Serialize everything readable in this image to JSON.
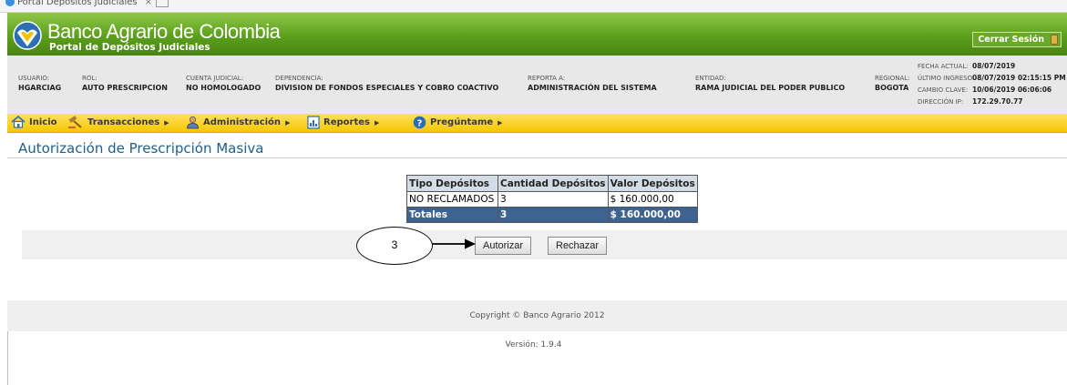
{
  "browser": {
    "tab_title": "Portal Depósitos Judiciales",
    "close_glyph": "×"
  },
  "header": {
    "bank_name": "Banco Agrario de Colombia",
    "portal_name": "Portal de Depósitos Judiciales",
    "logout_label": "Cerrar Sesión",
    "brand_color": "#5c9f1c"
  },
  "user_info": {
    "usuario": {
      "label": "USUARIO:",
      "value": "HGARCIAG"
    },
    "rol": {
      "label": "ROL:",
      "value": "AUTO PRESCRIPCION"
    },
    "cuenta": {
      "label": "CUENTA JUDICIAL:",
      "value": "NO HOMOLOGADO"
    },
    "dependencia": {
      "label": "DEPENDENCIA:",
      "value": "DIVISION DE FONDOS ESPECIALES Y COBRO COACTIVO"
    },
    "reporta": {
      "label": "REPORTA A:",
      "value": "ADMINISTRACIÓN DEL SISTEMA"
    },
    "entidad": {
      "label": "ENTIDAD:",
      "value": "RAMA JUDICIAL DEL PODER PUBLICO"
    },
    "regional": {
      "label": "REGIONAL:",
      "value": "BOGOTA"
    },
    "fecha_actual": {
      "label": "FECHA ACTUAL:",
      "value": "08/07/2019"
    },
    "ultimo_ingreso": {
      "label": "ÚLTIMO INGRESO:",
      "value": "08/07/2019 02:15:15 PM"
    },
    "cambio_clave": {
      "label": "CAMBIO CLAVE:",
      "value": "10/06/2019 06:06:06"
    },
    "direccion_ip": {
      "label": "DIRECCIÓN IP:",
      "value": "172.29.70.77"
    }
  },
  "menu": {
    "items": [
      {
        "label": "Inicio",
        "icon": "home-icon",
        "has_submenu": false
      },
      {
        "label": "Transacciones",
        "icon": "gavel-icon",
        "has_submenu": true
      },
      {
        "label": "Administración",
        "icon": "user-admin-icon",
        "has_submenu": true
      },
      {
        "label": "Reportes",
        "icon": "report-icon",
        "has_submenu": true
      },
      {
        "label": "Pregúntame",
        "icon": "help-icon",
        "has_submenu": true
      }
    ],
    "submenu_arrow": "▶"
  },
  "page": {
    "title": "Autorización de Prescripción Masiva"
  },
  "summary": {
    "headers": [
      "Tipo Depósitos",
      "Cantidad Depósitos",
      "Valor Depósitos"
    ],
    "rows": [
      [
        "NO RECLAMADOS",
        "3",
        "$ 160.000,00"
      ]
    ],
    "totals": [
      "Totales",
      "3",
      "$ 160.000,00"
    ]
  },
  "actions": {
    "authorize_label": "Autorizar",
    "reject_label": "Rechazar"
  },
  "annotation": {
    "step_number": "3"
  },
  "footer": {
    "copyright": "Copyright © Banco Agrario 2012",
    "version": "Versión: 1.9.4"
  }
}
